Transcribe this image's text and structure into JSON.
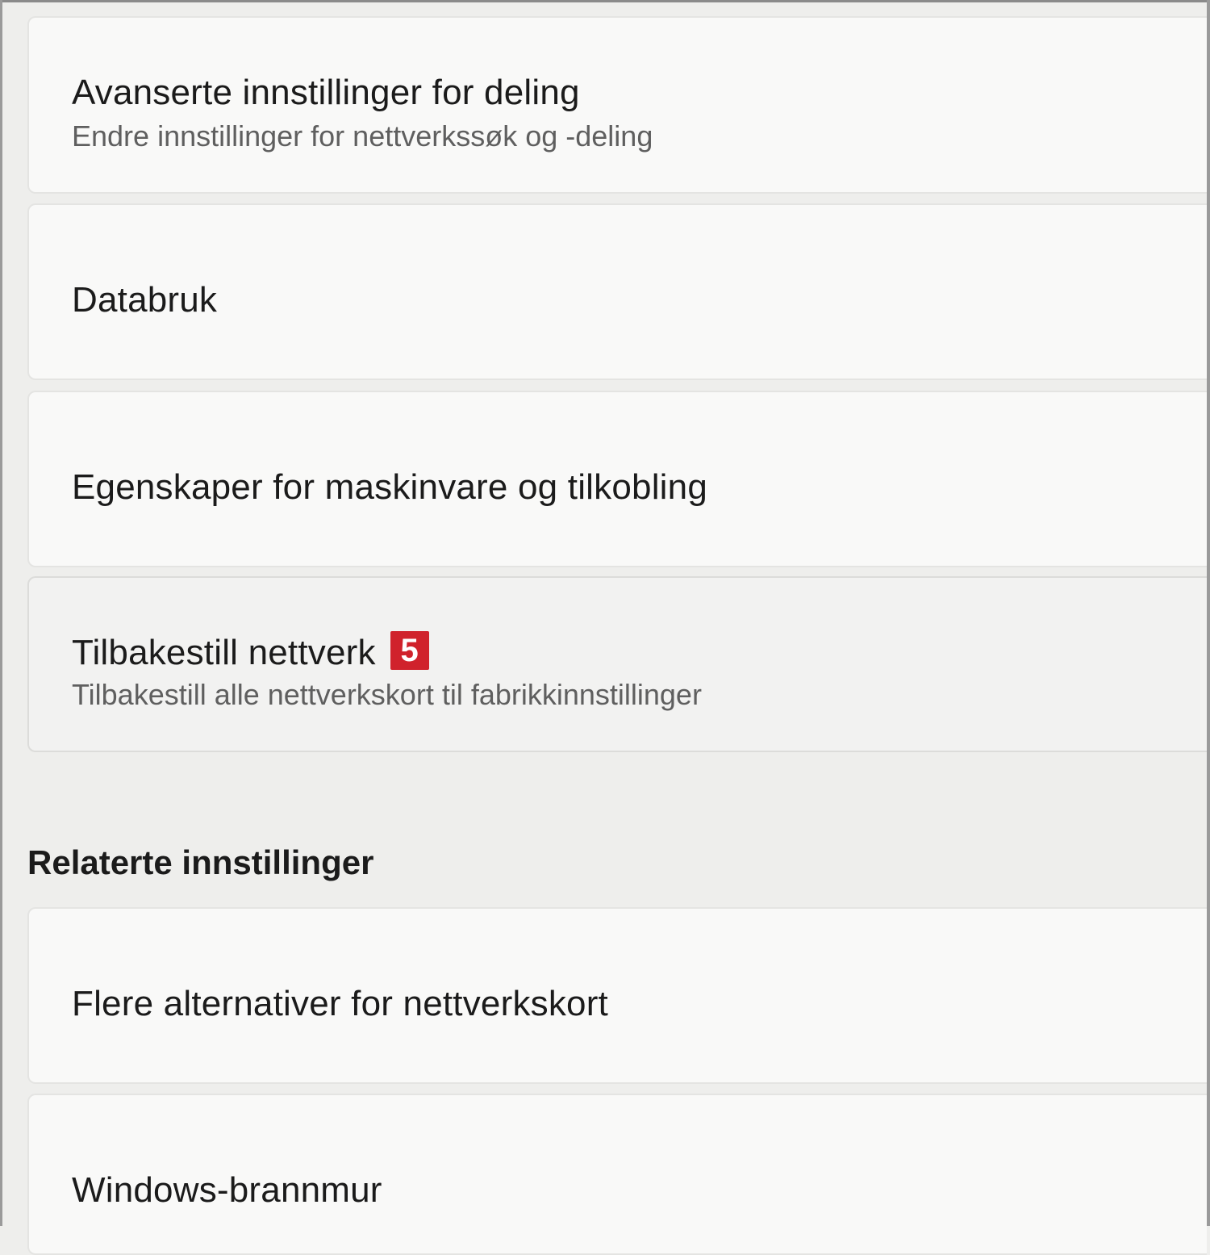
{
  "settings_list": [
    {
      "title": "Avanserte innstillinger for deling",
      "subtitle": "Endre innstillinger for nettverkssøk og -deling"
    },
    {
      "title": "Databruk"
    },
    {
      "title": "Egenskaper for maskinvare og tilkobling"
    },
    {
      "title": "Tilbakestill nettverk",
      "subtitle": "Tilbakestill alle nettverkskort til fabrikkinnstillinger",
      "badge": "5",
      "badge_color": "#d0222c"
    }
  ],
  "related": {
    "heading": "Relaterte innstillinger",
    "items": [
      {
        "title": "Flere alternativer for nettverkskort"
      },
      {
        "title": "Windows-brannmur"
      }
    ]
  }
}
